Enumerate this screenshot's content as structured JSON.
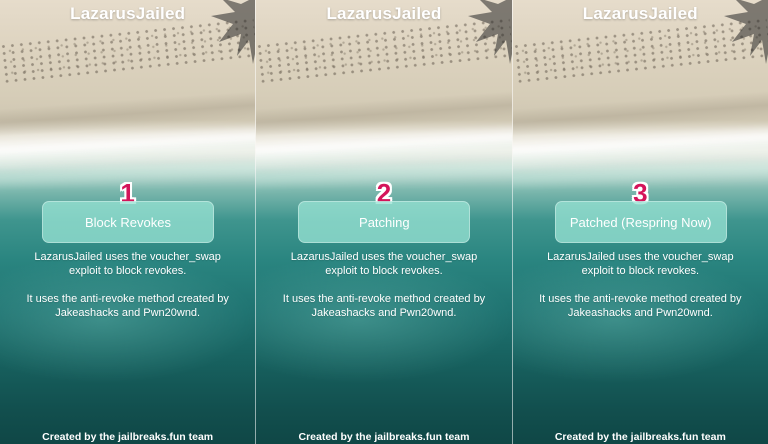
{
  "panels": [
    {
      "title": "LazarusJailed",
      "step": "1",
      "button_label": "Block Revokes",
      "description_1": "LazarusJailed uses the voucher_swap exploit to block revokes.",
      "description_2": "It uses the anti-revoke method created by Jakeashacks and Pwn20wnd.",
      "footer": "Created by the jailbreaks.fun team"
    },
    {
      "title": "LazarusJailed",
      "step": "2",
      "button_label": "Patching",
      "description_1": "LazarusJailed uses the voucher_swap exploit to block revokes.",
      "description_2": "It uses the anti-revoke method created by Jakeashacks and Pwn20wnd.",
      "footer": "Created by the jailbreaks.fun team"
    },
    {
      "title": "LazarusJailed",
      "step": "3",
      "button_label": "Patched (Respring Now)",
      "description_1": "LazarusJailed uses the voucher_swap exploit to block revokes.",
      "description_2": "It uses the anti-revoke method created by Jakeashacks and Pwn20wnd.",
      "footer": "Created by the jailbreaks.fun team"
    }
  ],
  "colors": {
    "step_number": "#d4145a",
    "button_fill": "#96e1d2",
    "text": "#ffffff"
  },
  "icons": {
    "background": "beach-aerial-image",
    "palm": "palm-shadow-icon"
  }
}
